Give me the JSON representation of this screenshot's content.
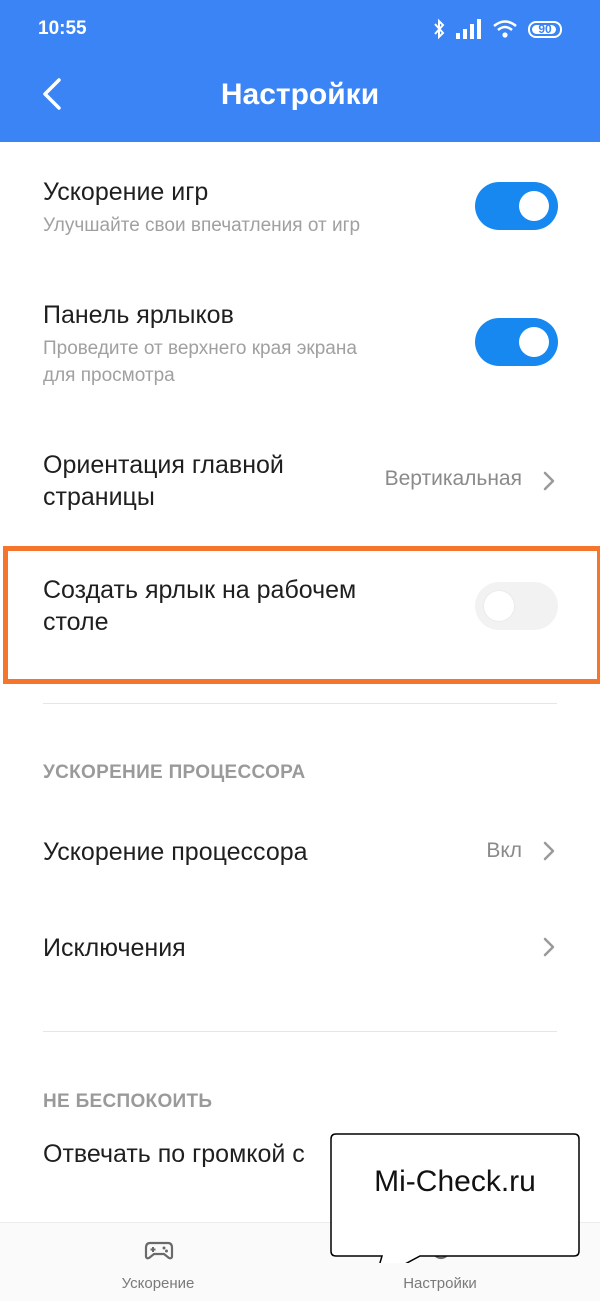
{
  "status_bar": {
    "time": "10:55",
    "battery": "90"
  },
  "header": {
    "title": "Настройки"
  },
  "settings": {
    "game_boost": {
      "title": "Ускорение игр",
      "subtitle": "Улучшайте свои впечатления от игр",
      "enabled": true
    },
    "shortcut_panel": {
      "title": "Панель ярлыков",
      "subtitle_line1": "Проведите от верхнего края экрана",
      "subtitle_line2": "для просмотра",
      "enabled": true
    },
    "orientation": {
      "title_line1": "Ориентация главной",
      "title_line2": "страницы",
      "value": "Вертикальная"
    },
    "desktop_shortcut": {
      "title_line1": "Создать ярлык на рабочем",
      "title_line2": "столе",
      "enabled": false
    }
  },
  "cpu_section": {
    "header": "УСКОРЕНИЕ ПРОЦЕССОРА",
    "cpu_boost": {
      "title": "Ускорение процессора",
      "value": "Вкл"
    },
    "exceptions": {
      "title": "Исключения"
    }
  },
  "dnd_section": {
    "header": "НЕ БЕСПОКОИТЬ",
    "volume_answer": {
      "title": "Отвечать по громкой с"
    }
  },
  "bottom_nav": [
    {
      "label": "Ускорение",
      "icon": "gamepad-icon"
    },
    {
      "label": "Настройки",
      "icon": "settings-icon"
    }
  ],
  "watermark": {
    "text": "Mi-Check.ru"
  },
  "colors": {
    "accent": "#3b84f5",
    "toggle_on": "#1788f0",
    "highlight": "#f5752c"
  }
}
